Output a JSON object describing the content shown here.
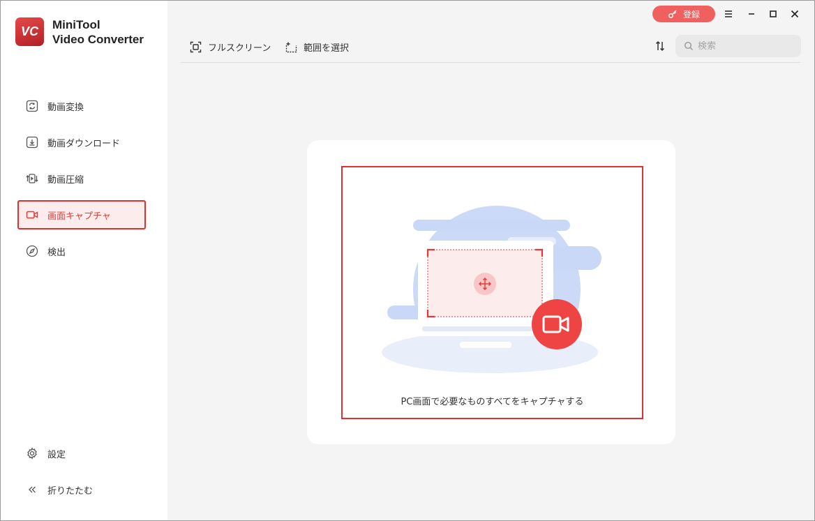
{
  "app": {
    "brand_line1": "MiniTool",
    "brand_line2": "Video Converter",
    "logo_text": "VC"
  },
  "titlebar": {
    "register_label": "登録"
  },
  "sidebar": {
    "items": [
      {
        "label": "動画変換",
        "icon": "convert-icon"
      },
      {
        "label": "動画ダウンロード",
        "icon": "download-icon"
      },
      {
        "label": "動画圧縮",
        "icon": "compress-icon"
      },
      {
        "label": "画面キャプチャ",
        "icon": "video-camera-icon",
        "active": true
      },
      {
        "label": "検出",
        "icon": "compass-icon"
      }
    ],
    "bottom": [
      {
        "label": "設定",
        "icon": "gear-icon"
      },
      {
        "label": "折りたたむ",
        "icon": "collapse-icon"
      }
    ]
  },
  "toolbar": {
    "fullscreen_label": "フルスクリーン",
    "region_label": "範囲を選択",
    "search_placeholder": "検索"
  },
  "main": {
    "caption": "PC画面で必要なものすべてをキャプチャする"
  },
  "colors": {
    "accent": "#e23a3a",
    "register_bg": "#f0605f",
    "illustration_blue": "#c9d8f7"
  }
}
